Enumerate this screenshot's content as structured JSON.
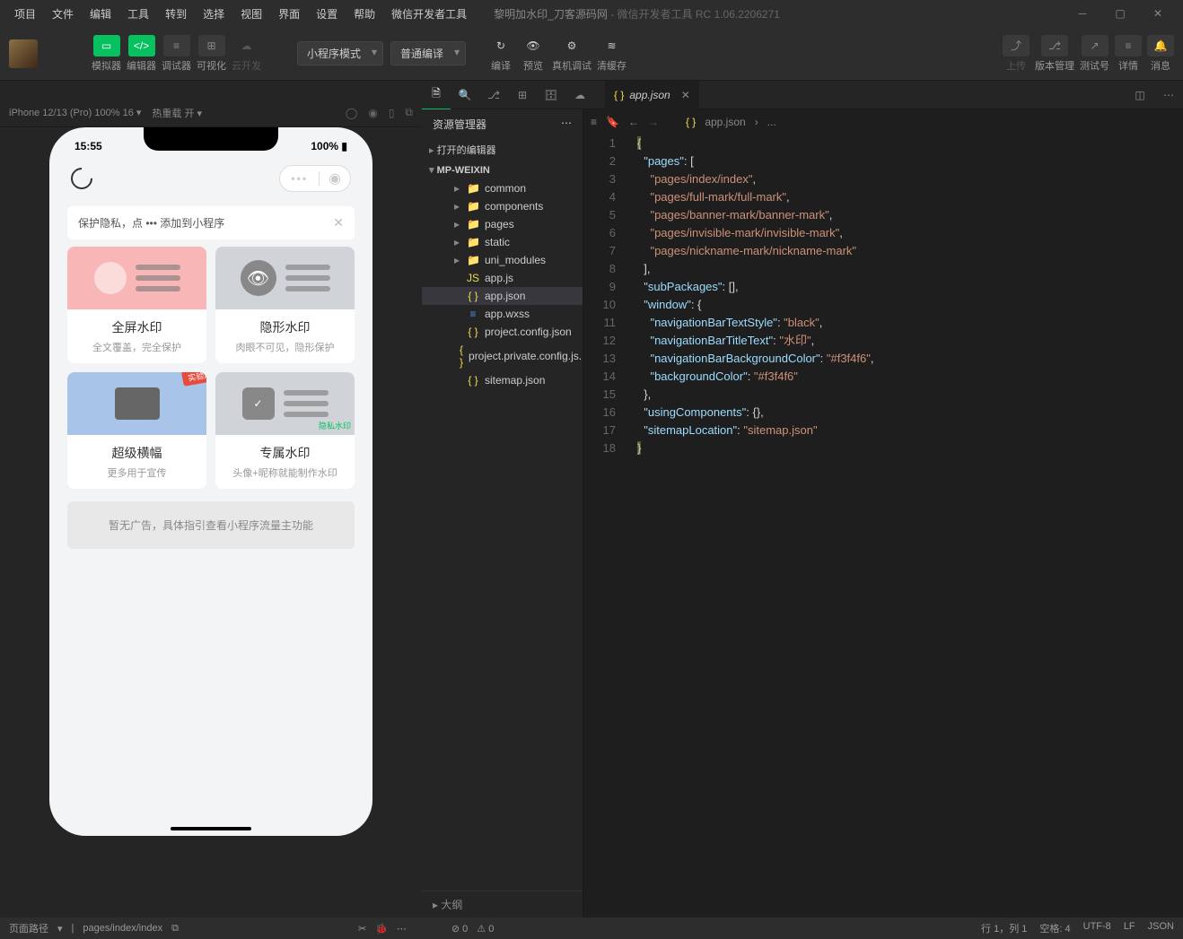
{
  "menu": [
    "项目",
    "文件",
    "编辑",
    "工具",
    "转到",
    "选择",
    "视图",
    "界面",
    "设置",
    "帮助",
    "微信开发者工具"
  ],
  "window_title": "黎明加水印_刀客源码网",
  "window_subtitle": " - 微信开发者工具 RC 1.06.2206271",
  "toolbar": {
    "simulator": "模拟器",
    "editor": "编辑器",
    "debugger": "调试器",
    "visualize": "可视化",
    "cloud": "云开发",
    "mode": "小程序模式",
    "compile": "普通编译",
    "compile_btn": "编译",
    "preview": "预览",
    "remote": "真机调试",
    "cache": "清缓存",
    "upload": "上传",
    "version": "版本管理",
    "testid": "测试号",
    "details": "详情",
    "msg": "消息"
  },
  "devicebar": {
    "device": "iPhone 12/13 (Pro) 100% 16",
    "hot": "热重载 开"
  },
  "phone": {
    "time": "15:55",
    "battery": "100%",
    "tip": "保护隐私，点 ••• 添加到小程序",
    "cards": [
      {
        "t": "全屏水印",
        "s": "全文覆盖，完全保护"
      },
      {
        "t": "隐形水印",
        "s": "肉眼不可见，隐形保护"
      },
      {
        "t": "超级横幅",
        "s": "更多用于宣传"
      },
      {
        "t": "专属水印",
        "s": "头像+昵称就能制作水印"
      }
    ],
    "stamp": "实验用水印",
    "wmtag": "隐私水印",
    "ad": "暂无广告，具体指引查看小程序流量主功能"
  },
  "explorer": {
    "title": "资源管理器",
    "open_editors": "打开的编辑器",
    "root": "MP-WEIXIN",
    "outline": "大纲",
    "tree": [
      {
        "n": "common",
        "t": "folder"
      },
      {
        "n": "components",
        "t": "folder"
      },
      {
        "n": "pages",
        "t": "folder"
      },
      {
        "n": "static",
        "t": "folder"
      },
      {
        "n": "uni_modules",
        "t": "folder"
      },
      {
        "n": "app.js",
        "t": "js"
      },
      {
        "n": "app.json",
        "t": "json",
        "sel": true
      },
      {
        "n": "app.wxss",
        "t": "wxss"
      },
      {
        "n": "project.config.json",
        "t": "json"
      },
      {
        "n": "project.private.config.js...",
        "t": "json"
      },
      {
        "n": "sitemap.json",
        "t": "json"
      }
    ]
  },
  "tab": {
    "name": "app.json"
  },
  "breadcrumb": {
    "file": "app.json",
    "more": "..."
  },
  "code_lines": [
    "1",
    "2",
    "3",
    "4",
    "5",
    "6",
    "7",
    "8",
    "9",
    "10",
    "11",
    "12",
    "13",
    "14",
    "15",
    "16",
    "17",
    "18"
  ],
  "status": {
    "path_label": "页面路径",
    "path": "pages/index/index",
    "err": "0",
    "warn": "0",
    "line": "行 1，列 1",
    "spaces": "空格: 4",
    "enc": "UTF-8",
    "eol": "LF",
    "lang": "JSON"
  }
}
